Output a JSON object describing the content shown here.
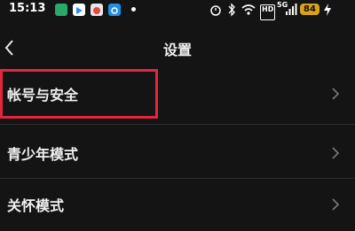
{
  "status_bar": {
    "time": "15:13",
    "battery": "84",
    "network_label": "HD",
    "signal_label": "5G"
  },
  "header": {
    "title": "设置",
    "back_icon": "chevron-left-icon"
  },
  "settings": {
    "items": [
      {
        "label": "帐号与安全",
        "highlighted": true
      },
      {
        "label": "青少年模式",
        "highlighted": false
      },
      {
        "label": "关怀模式",
        "highlighted": false
      }
    ]
  },
  "colors": {
    "background": "#141414",
    "highlight": "#e5253f",
    "battery": "#d8a21a"
  }
}
